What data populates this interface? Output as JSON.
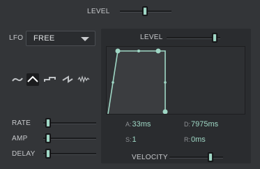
{
  "top": {
    "level_label": "LEVEL",
    "level_value": 0.42
  },
  "lfo": {
    "label": "LFO",
    "mode_value": "FREE",
    "waveforms": [
      "sine-wave",
      "triangle-wave",
      "square-wave",
      "saw-wave",
      "random-wave"
    ],
    "selected_waveform": "triangle-wave"
  },
  "sliders": {
    "rate_label": "RATE",
    "amp_label": "AMP",
    "delay_label": "DELAY"
  },
  "envelope": {
    "level_label": "LEVEL",
    "level_value": 0.95,
    "attack_key": "A:",
    "attack_value": "33ms",
    "decay_key": "D:",
    "decay_value": "7975ms",
    "sustain_key": "S:",
    "sustain_value": "1",
    "release_key": "R:",
    "release_value": "0ms",
    "velocity_label": "VELOCITY",
    "velocity_value": 0.77
  },
  "colors": {
    "accent": "#9fd7c5",
    "background": "#333538",
    "panel": "#2a2c2f"
  }
}
